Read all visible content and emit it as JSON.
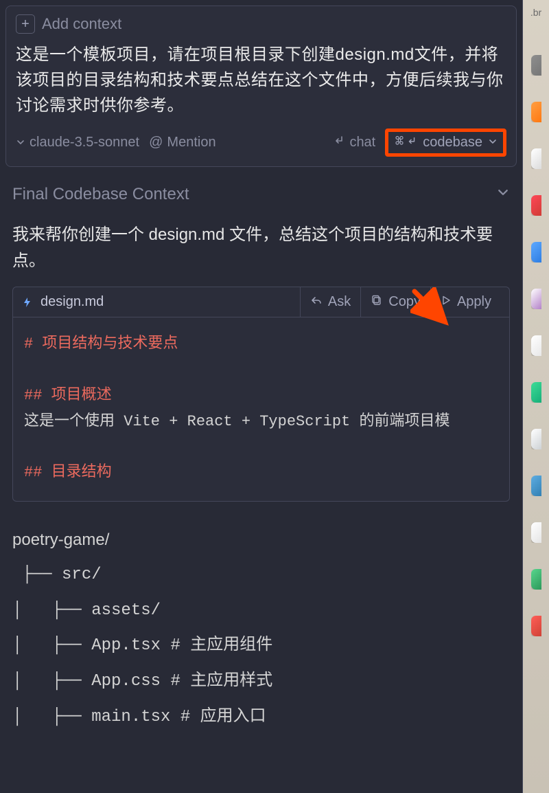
{
  "user_card": {
    "add_context_label": "Add context",
    "message": "这是一个模板项目，请在项目根目录下创建design.md文件，并将该项目的目录结构和技术要点总结在这个文件中，方便后续我与你讨论需求时供你参考。",
    "model_name": "claude-3.5-sonnet",
    "mention_label": "Mention",
    "chat_label": "chat",
    "codebase_label": "codebase"
  },
  "section": {
    "title": "Final Codebase Context"
  },
  "assistant_intro": "我来帮你创建一个 design.md 文件，总结这个项目的结构和技术要点。",
  "code_block": {
    "filename": "design.md",
    "actions": {
      "ask": "Ask",
      "copy": "Copy",
      "apply": "Apply"
    },
    "lines": [
      {
        "prefix": "# ",
        "text": "项目结构与技术要点",
        "kind": "h1"
      },
      {
        "prefix": "",
        "text": "",
        "kind": "blank"
      },
      {
        "prefix": "## ",
        "text": "项目概述",
        "kind": "h2"
      },
      {
        "prefix": "",
        "text": "这是一个使用 Vite + React + TypeScript 的前端项目模",
        "kind": "text"
      },
      {
        "prefix": "",
        "text": "",
        "kind": "blank"
      },
      {
        "prefix": "## ",
        "text": "目录结构",
        "kind": "h2"
      }
    ]
  },
  "tree": [
    "poetry-game/",
    "├── src/",
    "│ ├── assets/",
    "│ ├── App.tsx # 主应用组件",
    "│ ├── App.css # 主应用样式",
    "│ ├── main.tsx # 应用入口"
  ],
  "dock": {
    "partial_text": ".br",
    "icons": [
      {
        "name": "app-icon-1",
        "color1": "#8e8e8e",
        "color2": "#6e6e6e"
      },
      {
        "name": "app-icon-2",
        "color1": "#ff9f43",
        "color2": "#ff6b00"
      },
      {
        "name": "app-icon-3",
        "color1": "#ffffff",
        "color2": "#d0d0d0"
      },
      {
        "name": "app-icon-4",
        "color1": "#ff4757",
        "color2": "#c0392b"
      },
      {
        "name": "app-icon-5",
        "color1": "#5da9ff",
        "color2": "#1e6fd9"
      },
      {
        "name": "app-icon-6",
        "color1": "#ffffff",
        "color2": "#9b59b6"
      },
      {
        "name": "app-icon-7",
        "color1": "#ffffff",
        "color2": "#e0e0e0"
      },
      {
        "name": "app-icon-8",
        "color1": "#3ddc97",
        "color2": "#0a9f6f"
      },
      {
        "name": "app-icon-9",
        "color1": "#ffffff",
        "color2": "#bdc3c7"
      },
      {
        "name": "app-icon-10",
        "color1": "#5dade2",
        "color2": "#2471a3"
      },
      {
        "name": "app-icon-11",
        "color1": "#ffffff",
        "color2": "#dcdcdc"
      },
      {
        "name": "app-icon-12",
        "color1": "#58d68d",
        "color2": "#1e8449"
      },
      {
        "name": "app-icon-13",
        "color1": "#ff5e57",
        "color2": "#c0392b"
      }
    ]
  }
}
